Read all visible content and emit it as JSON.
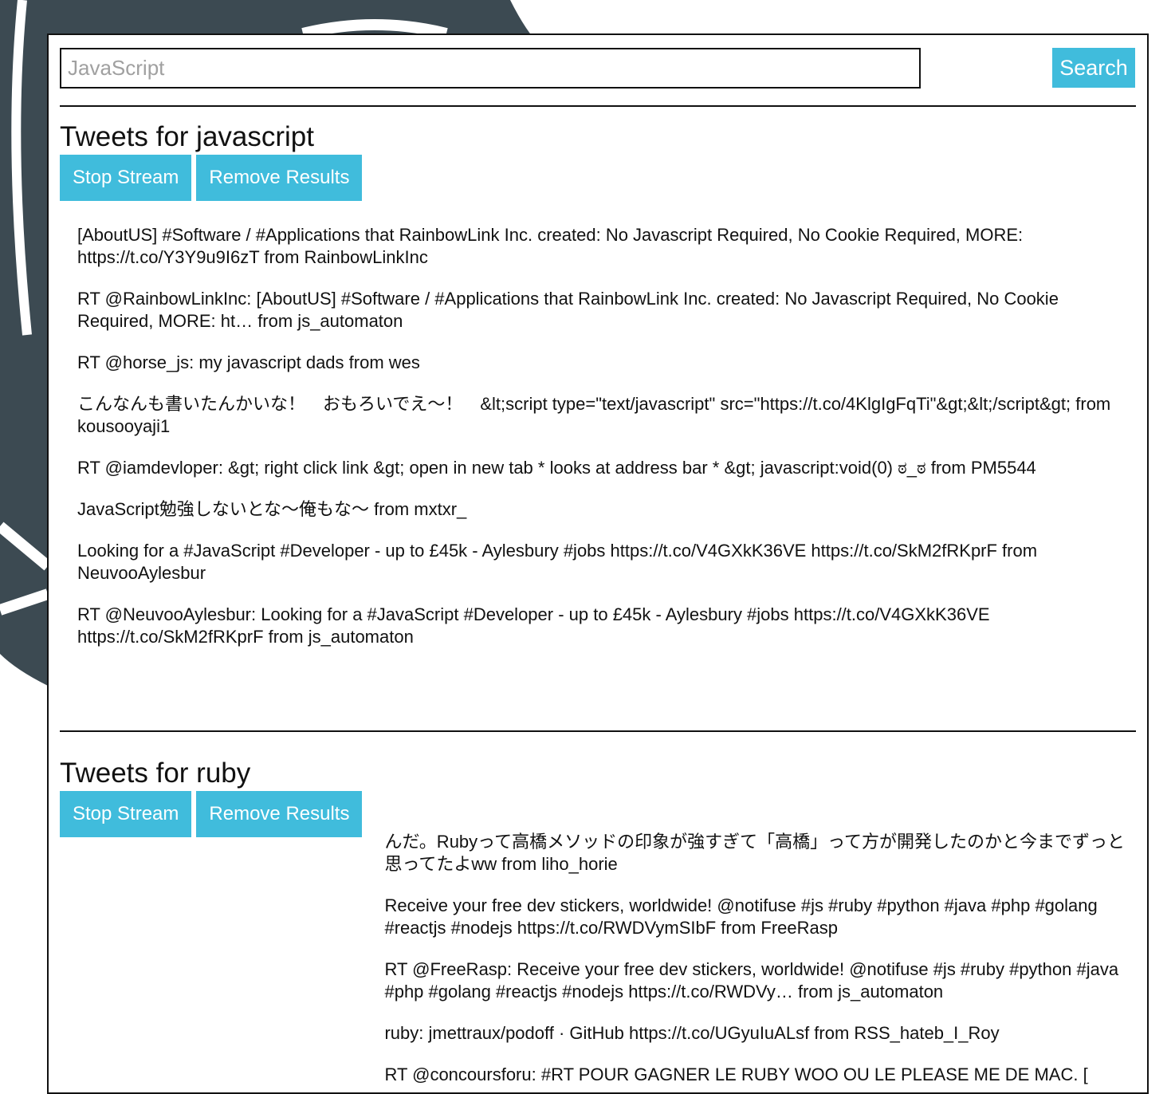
{
  "search": {
    "placeholder": "JavaScript",
    "value": "",
    "button_label": "Search"
  },
  "streams": [
    {
      "heading": "Tweets for javascript",
      "stop_label": "Stop Stream",
      "remove_label": "Remove Results",
      "tweets": [
        "[AboutUS] #Software / #Applications that RainbowLink Inc. created: No Javascript Required, No Cookie Required, MORE: https://t.co/Y3Y9u9I6zT from RainbowLinkInc",
        "RT @RainbowLinkInc: [AboutUS] #Software / #Applications that RainbowLink Inc. created: No Javascript Required, No Cookie Required, MORE: ht… from js_automaton",
        "RT @horse_js: my javascript dads from wes",
        "こんなんも書いたんかいな！　おもろいでえ〜！　&lt;script type=\"text/javascript\" src=\"https://t.co/4KlgIgFqTi\"&gt;&lt;/script&gt; from kousooyaji1",
        "RT @iamdevloper: &gt; right click link &gt; open in new tab * looks at address bar * &gt; javascript:void(0) ಠ_ಠ from PM5544",
        "JavaScript勉強しないとな〜俺もな〜 from mxtxr_",
        "Looking for a #JavaScript #Developer - up to £45k - Aylesbury #jobs https://t.co/V4GXkK36VE https://t.co/SkM2fRKprF from NeuvooAylesbur",
        "RT @NeuvooAylesbur: Looking for a #JavaScript #Developer - up to £45k - Aylesbury #jobs https://t.co/V4GXkK36VE https://t.co/SkM2fRKprF from js_automaton"
      ]
    },
    {
      "heading": "Tweets for ruby",
      "stop_label": "Stop Stream",
      "remove_label": "Remove Results",
      "tweets": [
        "んだ。Rubyって高橋メソッドの印象が強すぎて「高橋」って方が開発したのかと今までずっと思ってたよww from liho_horie",
        "Receive your free dev stickers, worldwide! @notifuse #js #ruby #python #java #php #golang #reactjs #nodejs https://t.co/RWDVymSIbF from FreeRasp",
        "RT @FreeRasp: Receive your free dev stickers, worldwide! @notifuse #js #ruby #python #java #php #golang #reactjs #nodejs https://t.co/RWDVy… from js_automaton",
        "ruby: jmettraux/podoff · GitHub https://t.co/UGyuIuALsf from RSS_hateb_I_Roy",
        "RT @concoursforu: #RT POUR GAGNER LE RUBY WOO OU LE PLEASE ME DE MAC. [ follow moi pour avoir une"
      ]
    }
  ],
  "colors": {
    "accent": "#40bcdc",
    "logo": "#3c4a52",
    "border": "#111111"
  }
}
